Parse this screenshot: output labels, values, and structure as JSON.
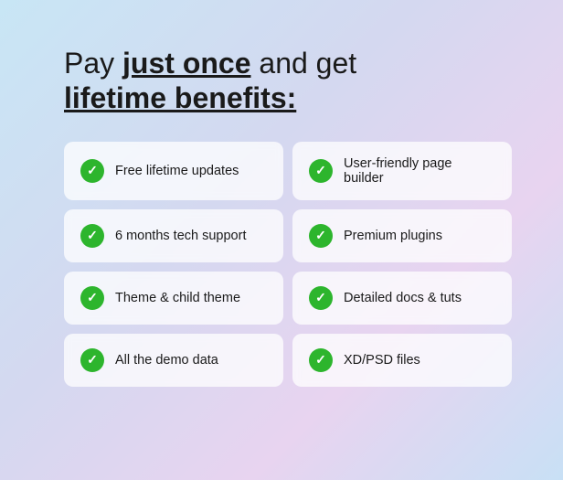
{
  "header": {
    "line1_prefix": "Pay ",
    "line1_emphasis": "just once",
    "line1_suffix": " and get",
    "line2": "lifetime benefits:"
  },
  "benefits": [
    {
      "id": "b1",
      "text": "Free lifetime updates"
    },
    {
      "id": "b2",
      "text": "User-friendly page builder"
    },
    {
      "id": "b3",
      "text": "6 months tech support"
    },
    {
      "id": "b4",
      "text": "Premium plugins"
    },
    {
      "id": "b5",
      "text": "Theme & child theme"
    },
    {
      "id": "b6",
      "text": "Detailed docs & tuts"
    },
    {
      "id": "b7",
      "text": "All the demo data"
    },
    {
      "id": "b8",
      "text": "XD/PSD files"
    }
  ]
}
